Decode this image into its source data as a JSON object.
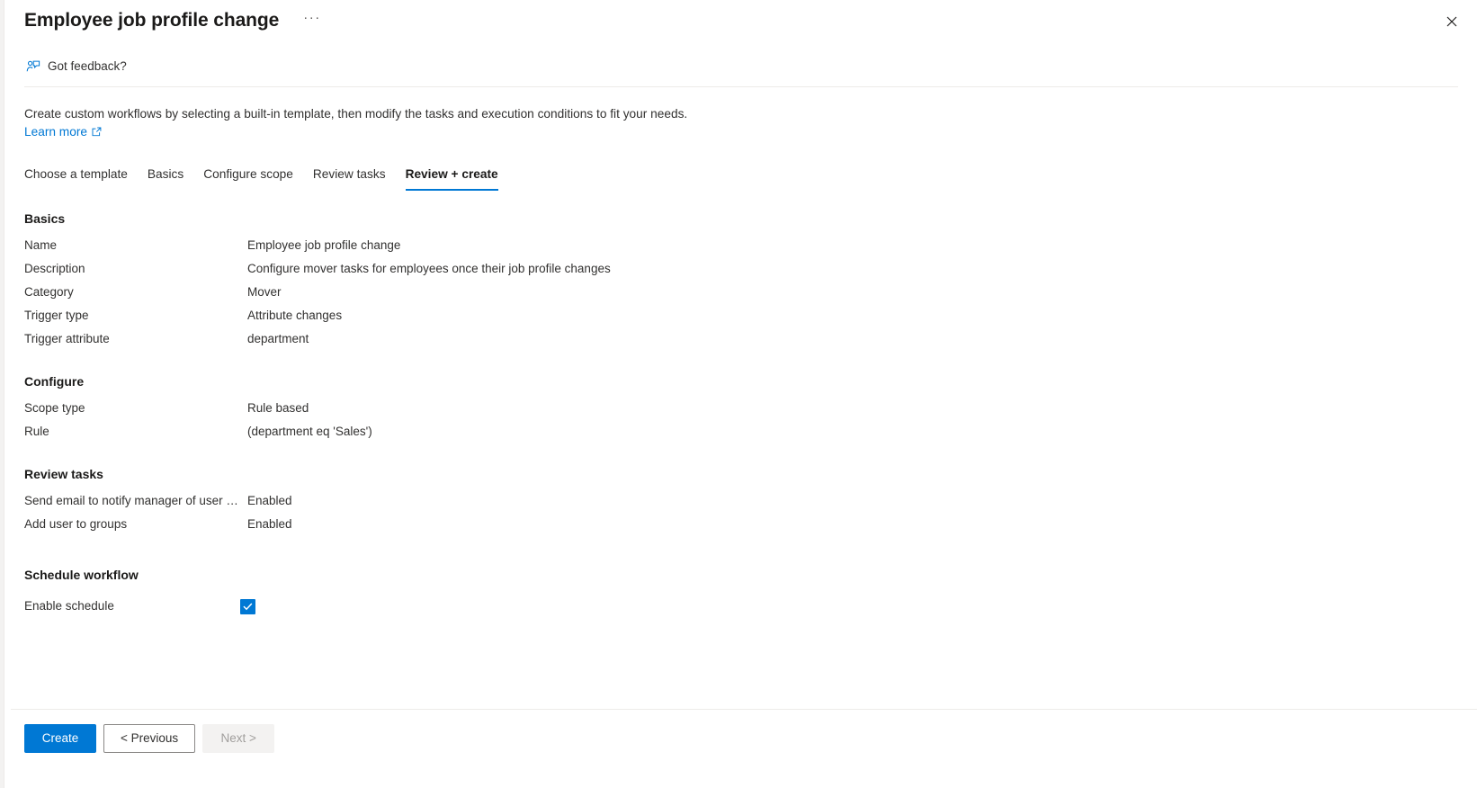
{
  "header": {
    "title": "Employee job profile change",
    "ellipsis_label": "···",
    "close_icon": "close-icon"
  },
  "commandbar": {
    "feedback_label": "Got feedback?",
    "feedback_icon": "feedback-person-icon"
  },
  "intro": {
    "description": "Create custom workflows by selecting a built-in template, then modify the tasks and execution conditions to fit your needs.",
    "learn_more_label": "Learn more",
    "learn_more_icon": "external-link-icon"
  },
  "tabs": [
    {
      "label": "Choose a template",
      "active": false
    },
    {
      "label": "Basics",
      "active": false
    },
    {
      "label": "Configure scope",
      "active": false
    },
    {
      "label": "Review tasks",
      "active": false
    },
    {
      "label": "Review + create",
      "active": true
    }
  ],
  "sections": [
    {
      "title": "Basics",
      "rows": [
        {
          "label": "Name",
          "value": "Employee job profile change"
        },
        {
          "label": "Description",
          "value": "Configure mover tasks for employees once their job profile changes"
        },
        {
          "label": "Category",
          "value": "Mover"
        },
        {
          "label": "Trigger type",
          "value": "Attribute changes"
        },
        {
          "label": "Trigger attribute",
          "value": "department"
        }
      ]
    },
    {
      "title": "Configure",
      "rows": [
        {
          "label": "Scope type",
          "value": "Rule based"
        },
        {
          "label": "Rule",
          "value": "(department eq 'Sales')"
        }
      ]
    },
    {
      "title": "Review tasks",
      "rows": [
        {
          "label": "Send email to notify manager of user mo…",
          "value": "Enabled"
        },
        {
          "label": "Add user to groups",
          "value": "Enabled"
        }
      ]
    }
  ],
  "schedule": {
    "title": "Schedule workflow",
    "enable_label": "Enable schedule",
    "enable_checked": true
  },
  "footer": {
    "create_label": "Create",
    "previous_label": "< Previous",
    "next_label": "Next >",
    "next_disabled": true
  },
  "colors": {
    "accent": "#0078d4",
    "link": "#0078d4",
    "text": "#323130",
    "heading": "#1b1a19",
    "disabled_text": "#a19f9d",
    "divider": "#edebe9"
  }
}
